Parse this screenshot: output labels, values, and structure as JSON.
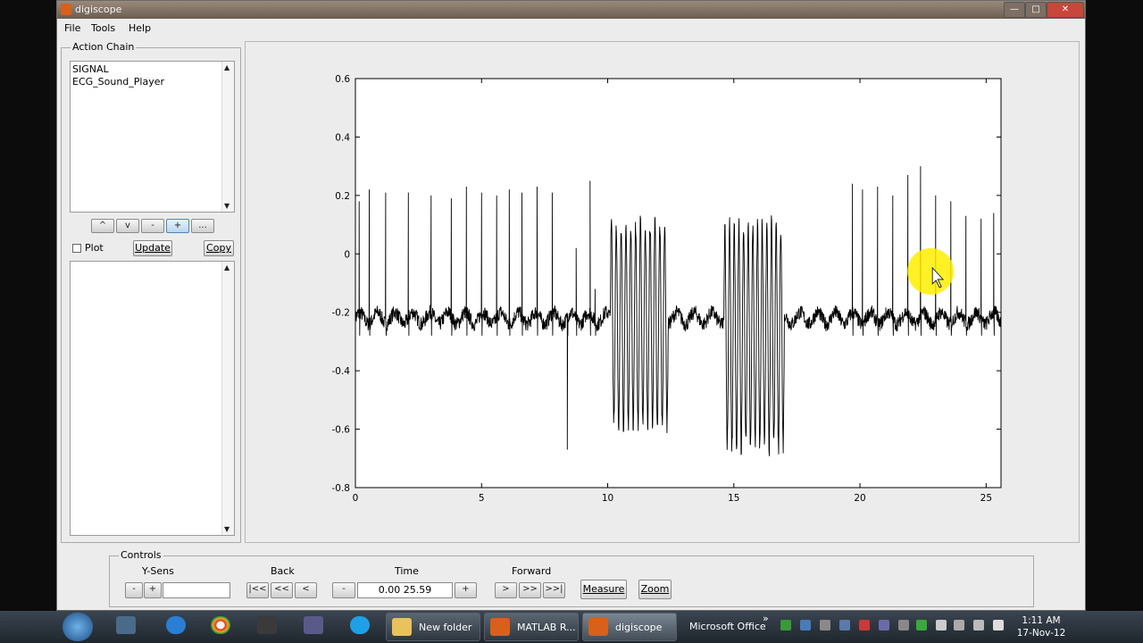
{
  "window": {
    "title": "digiscope",
    "min": "—",
    "max": "□",
    "close": "✕"
  },
  "menu": [
    "File",
    "Tools",
    "Help"
  ],
  "action_chain": {
    "label": "Action Chain",
    "items": [
      "SIGNAL",
      "ECG_Sound_Player"
    ],
    "tool_buttons": [
      "^",
      "v",
      "-",
      "+",
      "..."
    ],
    "plot_label": "Plot",
    "update_label": "Update",
    "copy_label": "Copy"
  },
  "controls": {
    "label": "Controls",
    "ysens_label": "Y-Sens",
    "ysens_minus": "-",
    "ysens_plus": "+",
    "ysens_value": "",
    "back_label": "Back",
    "back_buttons": [
      "|<<",
      "<<",
      "<"
    ],
    "time_label": "Time",
    "time_minus": "-",
    "time_value": "0.00 25.59",
    "time_plus": "+",
    "forward_label": "Forward",
    "forward_buttons": [
      ">",
      ">>",
      ">>|"
    ],
    "measure_label": "Measure",
    "zoom_label": "Zoom"
  },
  "chart_data": {
    "type": "line",
    "xlim": [
      0,
      25.59
    ],
    "ylim": [
      -0.8,
      0.6
    ],
    "xticks": [
      "0",
      "5",
      "10",
      "15",
      "20",
      "25"
    ],
    "yticks": [
      "0.6",
      "0.4",
      "0.2",
      "0",
      "-0.2",
      "-0.4",
      "-0.6",
      "-0.8"
    ],
    "grid": false,
    "baseline": -0.22,
    "spikes": [
      {
        "x": 0.15,
        "y": 0.18
      },
      {
        "x": 0.55,
        "y": 0.22
      },
      {
        "x": 1.2,
        "y": 0.21
      },
      {
        "x": 2.1,
        "y": 0.21
      },
      {
        "x": 3.0,
        "y": 0.2
      },
      {
        "x": 3.8,
        "y": 0.19
      },
      {
        "x": 4.4,
        "y": 0.23
      },
      {
        "x": 5.0,
        "y": 0.21
      },
      {
        "x": 5.6,
        "y": 0.2
      },
      {
        "x": 6.1,
        "y": 0.22
      },
      {
        "x": 6.6,
        "y": 0.21
      },
      {
        "x": 7.2,
        "y": 0.23
      },
      {
        "x": 7.8,
        "y": 0.21
      },
      {
        "x": 8.4,
        "y": -0.67
      },
      {
        "x": 8.75,
        "y": 0.02
      },
      {
        "x": 9.3,
        "y": 0.25
      },
      {
        "x": 9.5,
        "y": -0.12
      },
      {
        "x": 19.7,
        "y": 0.24
      },
      {
        "x": 20.1,
        "y": 0.22
      },
      {
        "x": 20.7,
        "y": 0.23
      },
      {
        "x": 21.3,
        "y": 0.2
      },
      {
        "x": 21.9,
        "y": 0.27
      },
      {
        "x": 22.4,
        "y": 0.3
      },
      {
        "x": 23.0,
        "y": 0.2
      },
      {
        "x": 23.6,
        "y": 0.18
      },
      {
        "x": 24.2,
        "y": 0.13
      },
      {
        "x": 24.8,
        "y": 0.12
      },
      {
        "x": 25.3,
        "y": 0.14
      }
    ],
    "bursts": [
      {
        "xstart": 10.1,
        "xend": 12.4,
        "high": 0.14,
        "low": -0.62,
        "cycles": 12
      },
      {
        "xstart": 14.6,
        "xend": 17.0,
        "high": 0.14,
        "low": -0.7,
        "cycles": 13
      }
    ]
  },
  "cursor_highlight_color": "#ffee00",
  "taskbar": {
    "tasks": [
      "New folder",
      "MATLAB R...",
      "digiscope",
      "Microsoft Office"
    ],
    "clock_time": "1:11 AM",
    "clock_date": "17-Nov-12"
  }
}
